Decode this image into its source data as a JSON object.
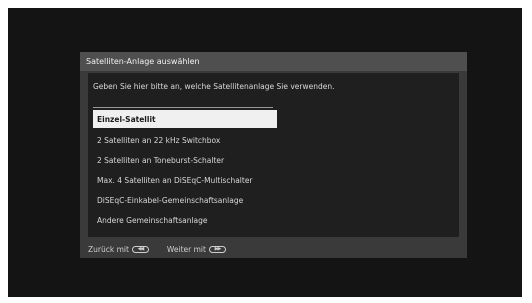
{
  "dialog": {
    "title": "Satelliten-Anlage auswählen",
    "instruction": "Geben Sie hier bitte an, welche Satellitenanlage Sie verwenden."
  },
  "options": [
    {
      "label": "Einzel-Satellit",
      "selected": true
    },
    {
      "label": "2 Satelliten an 22 kHz Switchbox",
      "selected": false
    },
    {
      "label": "2 Satelliten an Toneburst-Schalter",
      "selected": false
    },
    {
      "label": "Max. 4 Satelliten an DiSEqC-Multischalter",
      "selected": false
    },
    {
      "label": "DiSEqC-Einkabel-Gemeinschaftsanlage",
      "selected": false
    },
    {
      "label": "Andere Gemeinschaftsanlage",
      "selected": false
    }
  ],
  "footer": {
    "back_label": "Zurück mit",
    "back_icon": "rewind-key-icon",
    "next_label": "Weiter mit",
    "next_icon": "fast-forward-key-icon"
  },
  "colors": {
    "screen_background": "#141414",
    "dialog_background": "#3a3a3a",
    "title_bar": "#4f4f4f",
    "selected_highlight": "#f0f0f0"
  }
}
